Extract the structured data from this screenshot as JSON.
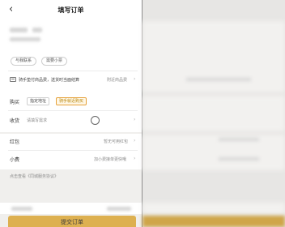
{
  "header": {
    "back_icon": "chevron-left-icon",
    "back_glyph": "‹",
    "title": "填写订单"
  },
  "tags": [
    "与我联系",
    "需要小票"
  ],
  "purchase_hint": {
    "text": "骑手垫付商品费，送货时当面结算",
    "link": "附近商品费",
    "arrow": "›"
  },
  "buy_row": {
    "label": "购买",
    "options": [
      "指定地址",
      "骑手就近购买"
    ],
    "selected_index": 1
  },
  "receive_row": {
    "label": "收货",
    "placeholder": "请填写需求",
    "arrow": "›"
  },
  "red_packet_row": {
    "label": "红包",
    "value": "暂无可用红包",
    "arrow": "›"
  },
  "tip_row": {
    "label": "小费",
    "value": "加小费接单更快哦",
    "arrow": "›"
  },
  "agreement": "点击查看《同城服务协议》",
  "submit_label": "提交订单",
  "colors": {
    "accent": "#ddb050",
    "page_bg": "#f0efed",
    "selected_tag": "#e6a23c"
  }
}
